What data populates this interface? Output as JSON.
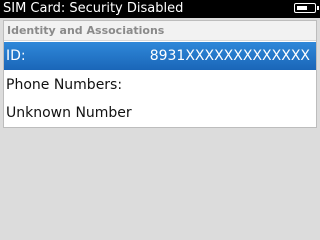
{
  "status_bar": {
    "title": "SIM Card: Security Disabled",
    "battery_icon": "battery-icon",
    "battery_level": 0.6
  },
  "section": {
    "header": "Identity and Associations"
  },
  "rows": [
    {
      "label": "ID:",
      "value": "8931XXXXXXXXXXXXX",
      "selected": true
    },
    {
      "label": "Phone Numbers:",
      "value": ""
    },
    {
      "label": "Unknown Number",
      "value": ""
    }
  ],
  "colors": {
    "selection": "#2f88d9",
    "status_bar_bg": "#000000",
    "background": "#dcdcdc"
  }
}
